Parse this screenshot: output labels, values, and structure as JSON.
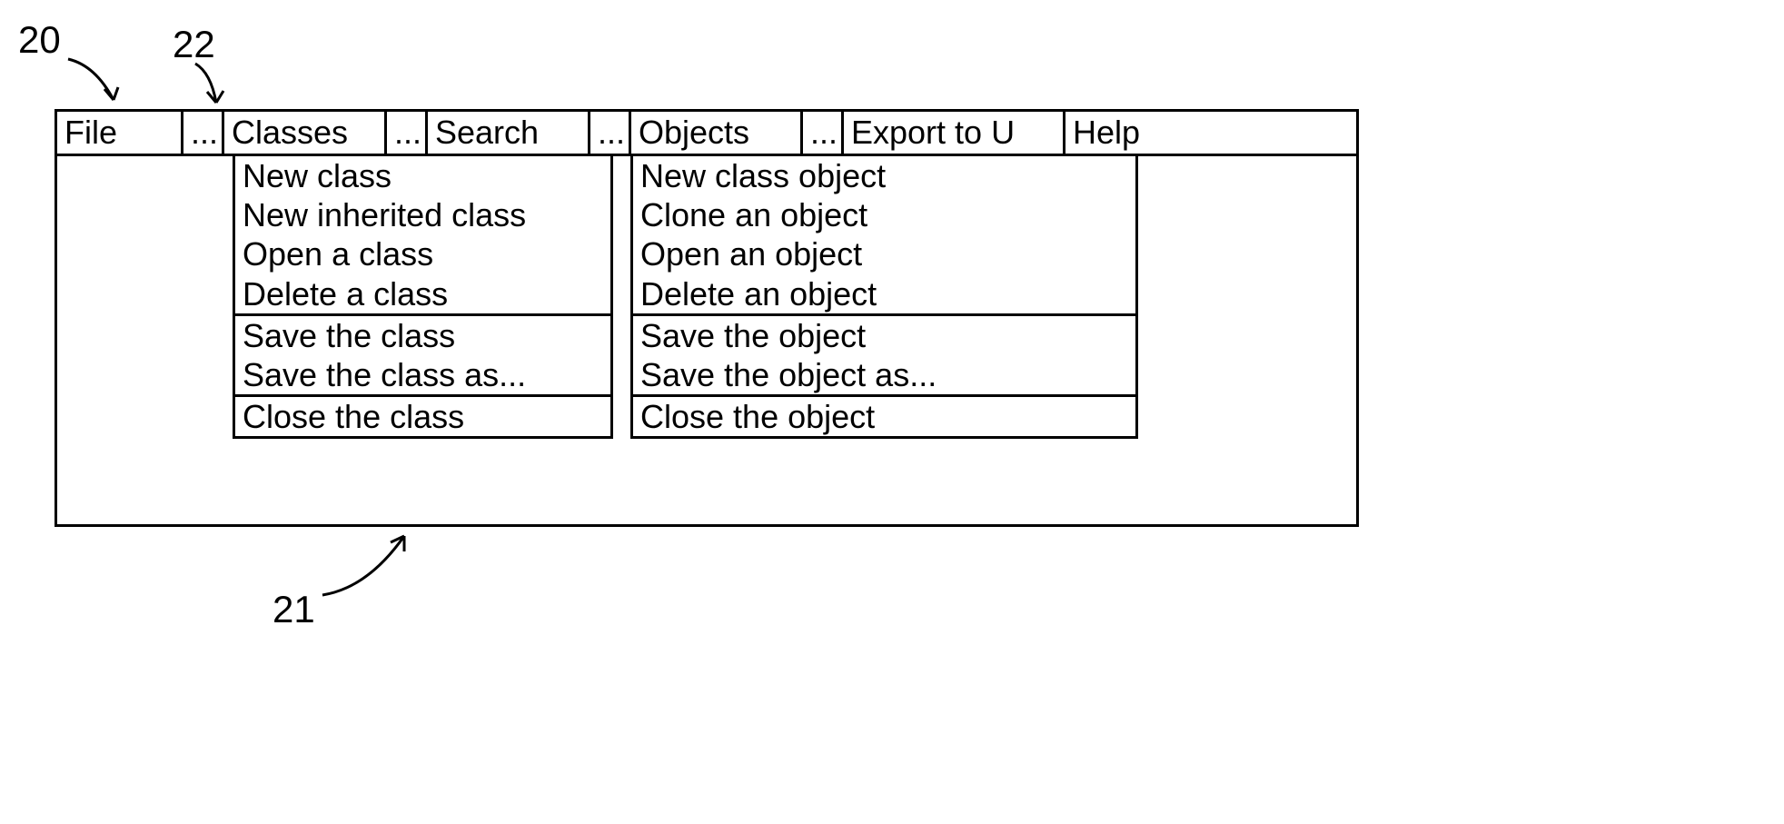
{
  "callouts": {
    "ref20": "20",
    "ref22": "22",
    "ref21": "21"
  },
  "menubar": {
    "file": "File",
    "pinch1": "...",
    "classes": "Classes",
    "pinch2": "...",
    "search": "Search",
    "pinch3": "...",
    "objects": "Objects",
    "pinch4": "...",
    "export": "Export to U",
    "help": "Help"
  },
  "dropdowns": {
    "classes": {
      "group1": [
        "New class",
        "New inherited class",
        "Open a class",
        "Delete a class"
      ],
      "group2": [
        "Save the class",
        "Save the class as..."
      ],
      "group3": [
        "Close the class"
      ]
    },
    "objects": {
      "group1": [
        "New class object",
        "Clone an object",
        "Open an object",
        "Delete an object"
      ],
      "group2": [
        "Save the object",
        "Save the object as..."
      ],
      "group3": [
        "Close the object"
      ]
    }
  }
}
